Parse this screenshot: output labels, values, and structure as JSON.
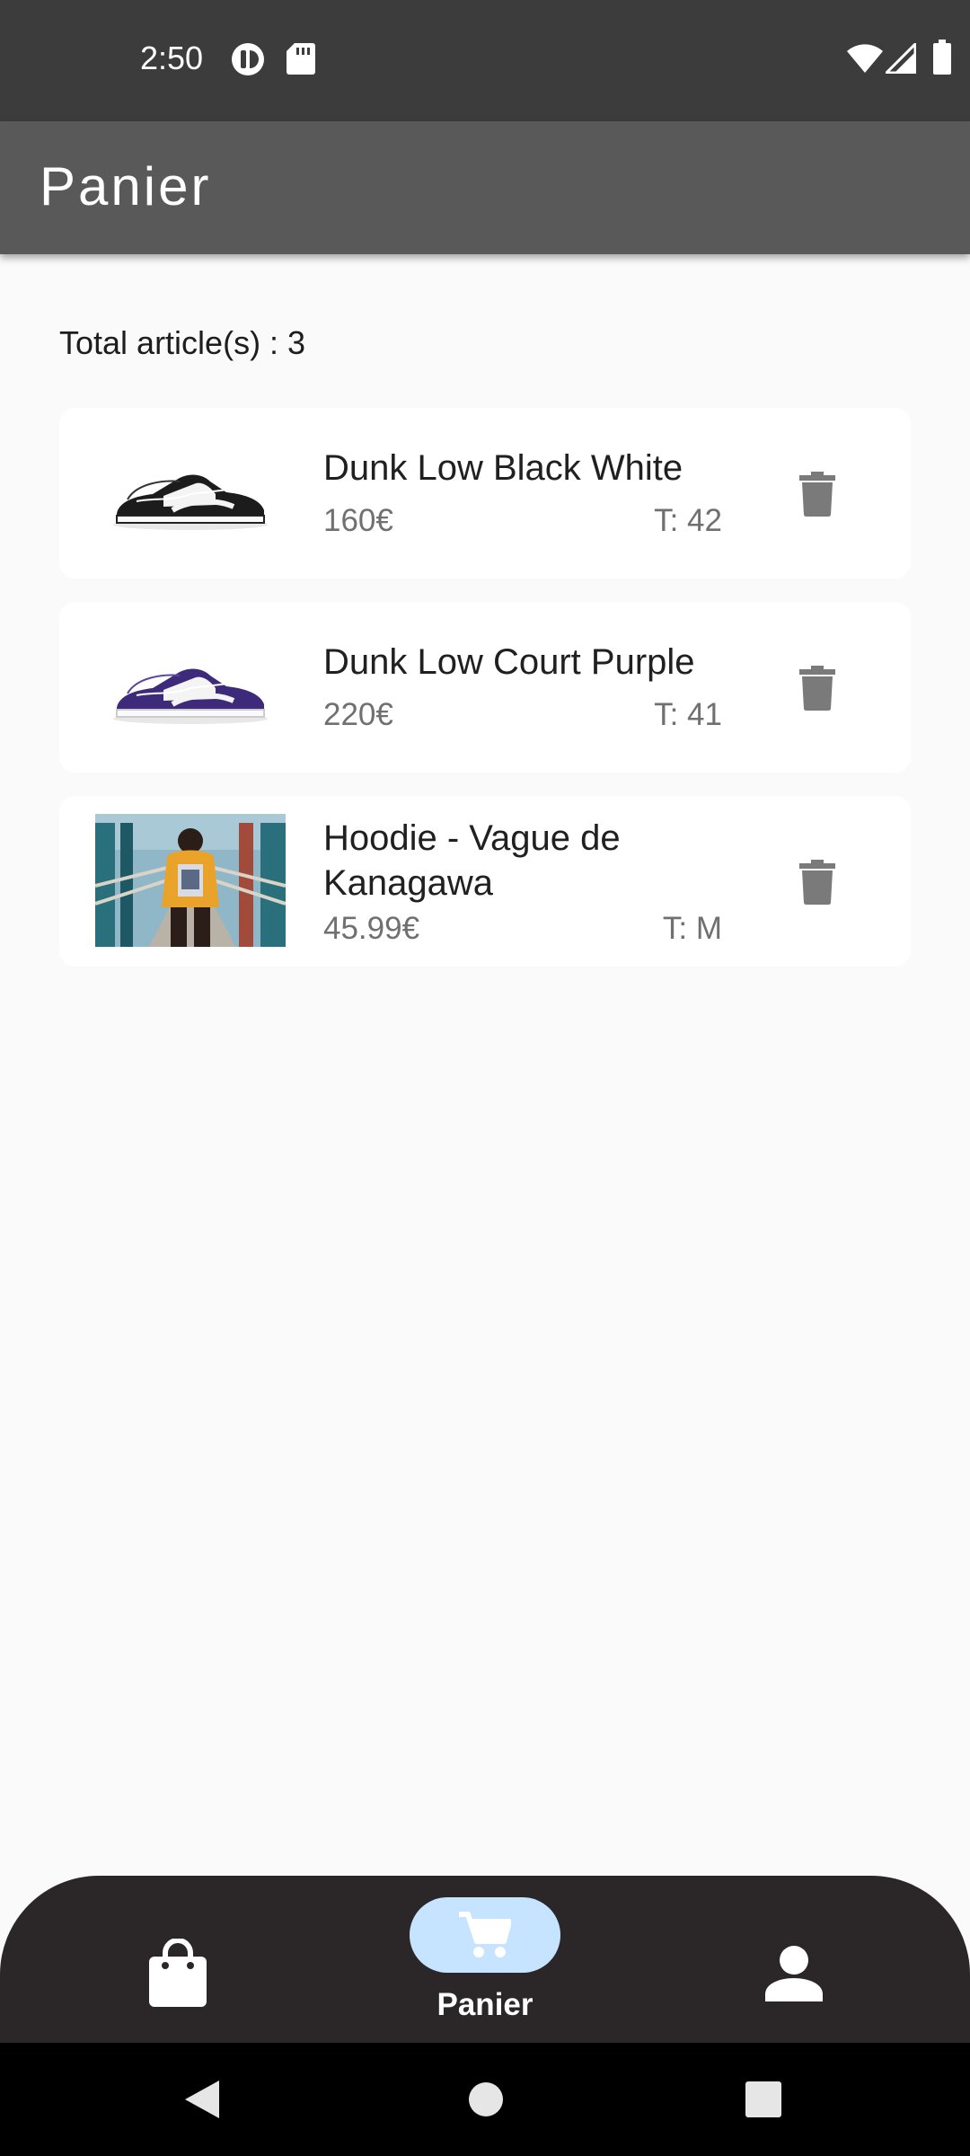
{
  "status_bar": {
    "time": "2:50",
    "icons": [
      "app-notification-icon",
      "sd-card-icon",
      "wifi-icon",
      "signal-icon",
      "battery-icon"
    ]
  },
  "app_bar": {
    "title": "Panier"
  },
  "cart": {
    "total_label": "Total article(s) : 3",
    "items": [
      {
        "name": "Dunk Low Black White",
        "price": "160€",
        "size": "T: 42",
        "image": "sneaker-black-white"
      },
      {
        "name": "Dunk Low Court Purple",
        "price": "220€",
        "size": "T: 41",
        "image": "sneaker-court-purple"
      },
      {
        "name": "Hoodie - Vague de Kanagawa",
        "price": "45.99€",
        "size": "T: M",
        "image": "hoodie-orange-photo"
      }
    ]
  },
  "bottom_nav": {
    "items": [
      {
        "icon": "shopping-bag-icon",
        "label": ""
      },
      {
        "icon": "cart-icon",
        "label": "Panier",
        "selected": true
      },
      {
        "icon": "person-icon",
        "label": ""
      }
    ],
    "selected_color": "#c6e3ff"
  },
  "system_nav": {
    "icons": [
      "back-icon",
      "home-icon",
      "recents-icon"
    ]
  },
  "colors": {
    "status_bar": "#3c3c3c",
    "app_bar": "#595959",
    "background": "#fafafa",
    "card": "#ffffff",
    "bottom_nav": "#2b2628",
    "delete_icon": "#7a7a7a"
  }
}
